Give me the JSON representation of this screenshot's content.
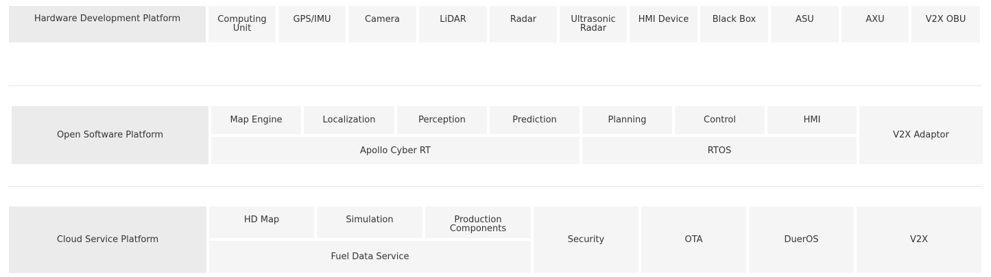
{
  "hardware": {
    "title": "Hardware Development Platform",
    "items": [
      "Computing\nUnit",
      "GPS/IMU",
      "Camera",
      "LiDAR",
      "Radar",
      "Ultrasonic\nRadar",
      "HMI Device",
      "Black Box",
      "ASU",
      "AXU",
      "V2X OBU"
    ]
  },
  "software": {
    "title": "Open Software Platform",
    "modules": [
      "Map Engine",
      "Localization",
      "Perception",
      "Prediction",
      "Planning",
      "Control",
      "HMI"
    ],
    "runtime": [
      "Apollo Cyber RT",
      "RTOS"
    ],
    "adaptor": "V2X Adaptor"
  },
  "cloud": {
    "title": "Cloud Service Platform",
    "services_top": [
      "HD Map",
      "Simulation",
      "Production\nComponents"
    ],
    "data_service": "Fuel Data Service",
    "services_side": [
      "Security",
      "OTA",
      "DuerOS",
      "V2X"
    ]
  },
  "colors": {
    "cell_bg": "#f5f5f5",
    "header_bg": "#ebebeb",
    "divider": "#e3e3e3",
    "text": "#333333"
  }
}
